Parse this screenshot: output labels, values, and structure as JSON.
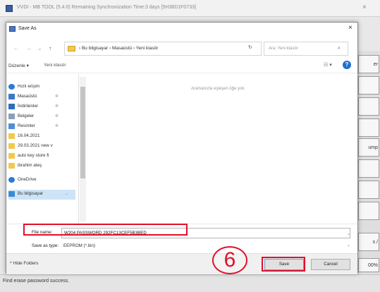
{
  "app": {
    "title": "VVDI - MB TOOL (5.4.0)     Remaining Synchronization Time:3 days     [5H38D1F0733]",
    "close_glyph": "×",
    "status_text": "Find erase password success.",
    "side_buttons": [
      "er",
      "",
      "",
      "",
      "ump",
      "",
      "",
      "",
      "s /"
    ],
    "progress_text": "00%"
  },
  "dialog": {
    "title": "Save As",
    "close_glyph": "×",
    "nav": {
      "back_glyph": "←",
      "forward_glyph": "→",
      "recent_glyph": "⌄",
      "up_glyph": "↑",
      "address": "› Bu bilgisayar › Masaüstü › Yeni klasör",
      "address_caret": "⌄",
      "refresh_glyph": "↻",
      "search_placeholder": "Ara: Yeni klasör",
      "search_glyph": "⌕"
    },
    "toolbar": {
      "organize": "Düzenle ▾",
      "new_folder": "Yeni klasör",
      "view_glyph": "☷ ▾",
      "help_glyph": "?"
    },
    "nav_pane": [
      {
        "label": "Hızlı erişim",
        "icon": "star-icon",
        "color": "#2a7bd6",
        "pinned": false,
        "selected": false
      },
      {
        "label": "Masaüstü",
        "icon": "desktop-icon",
        "color": "#3a78c8",
        "pinned": true,
        "selected": false
      },
      {
        "label": "İndirilenler",
        "icon": "download-icon",
        "color": "#2a6fc0",
        "pinned": true,
        "selected": false
      },
      {
        "label": "Belgeler",
        "icon": "documents-icon",
        "color": "#8aa0b8",
        "pinned": true,
        "selected": false
      },
      {
        "label": "Resimler",
        "icon": "pictures-icon",
        "color": "#4f8fd6",
        "pinned": true,
        "selected": false
      },
      {
        "label": "16.04.2021",
        "icon": "folder-icon",
        "color": "#f2c94c",
        "pinned": false,
        "selected": false
      },
      {
        "label": "29.03.2021 new v",
        "icon": "folder-icon",
        "color": "#f2c94c",
        "pinned": false,
        "selected": false
      },
      {
        "label": "auto key store fi",
        "icon": "folder-icon",
        "color": "#f2c94c",
        "pinned": false,
        "selected": false
      },
      {
        "label": "ibrahim ateş",
        "icon": "folder-icon",
        "color": "#f2c94c",
        "pinned": false,
        "selected": false
      },
      {
        "label": "OneDrive",
        "icon": "cloud-icon",
        "color": "#2a7bd6",
        "pinned": false,
        "selected": false
      },
      {
        "label": "Bu bilgisayar",
        "icon": "computer-icon",
        "color": "#3a8ad6",
        "pinned": false,
        "selected": true
      }
    ],
    "pin_glyph": "✲",
    "nav_expand_glyph": "⌄",
    "empty_message": "Aramanızla eşleşen öğe yok.",
    "file_name_label": "File name:",
    "file_name_value": "W204 PASSWORD 292FC13CEF5B3BED",
    "file_name_caret": "⌄",
    "save_type_label": "Save as type:",
    "save_type_value": "EEPROM (*.bin)",
    "save_type_caret": "⌄",
    "hide_folders": "^  Hide Folders",
    "save_label": "Save",
    "cancel_label": "Cancel"
  },
  "annotation": {
    "step_number": "6",
    "highlight_color": "#e0102a"
  }
}
